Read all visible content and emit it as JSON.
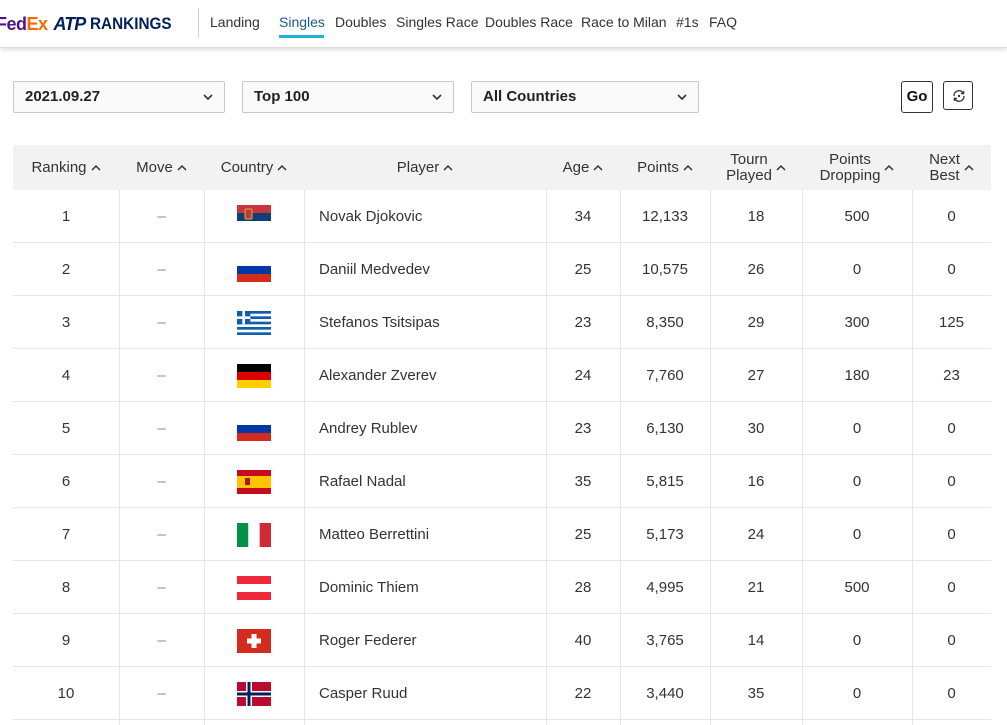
{
  "brand": {
    "fed": "Fed",
    "ex": "Ex",
    "atp": "ATP",
    "rankings": "RANKINGS"
  },
  "nav": {
    "items": [
      "Landing",
      "Singles",
      "Doubles",
      "Singles Race",
      "Doubles Race",
      "Race to Milan",
      "#1s",
      "FAQ"
    ],
    "active": "Singles"
  },
  "filters": {
    "date": "2021.09.27",
    "range": "Top 100",
    "country": "All Countries",
    "go_label": "Go",
    "reset_icon": "reset-icon"
  },
  "table": {
    "headers": {
      "ranking": "Ranking",
      "move": "Move",
      "country": "Country",
      "player": "Player",
      "age": "Age",
      "points": "Points",
      "tourn_line1": "Tourn",
      "tourn_line2": "Played",
      "dropping_line1": "Points",
      "dropping_line2": "Dropping",
      "next_line1": "Next",
      "next_line2": "Best"
    },
    "rows": [
      {
        "ranking": "1",
        "move": "–",
        "country": "SRB",
        "player": "Novak Djokovic",
        "age": "34",
        "points": "12,133",
        "tourn": "18",
        "dropping": "500",
        "next": "0"
      },
      {
        "ranking": "2",
        "move": "–",
        "country": "RUS",
        "player": "Daniil Medvedev",
        "age": "25",
        "points": "10,575",
        "tourn": "26",
        "dropping": "0",
        "next": "0"
      },
      {
        "ranking": "3",
        "move": "–",
        "country": "GRE",
        "player": "Stefanos Tsitsipas",
        "age": "23",
        "points": "8,350",
        "tourn": "29",
        "dropping": "300",
        "next": "125"
      },
      {
        "ranking": "4",
        "move": "–",
        "country": "GER",
        "player": "Alexander Zverev",
        "age": "24",
        "points": "7,760",
        "tourn": "27",
        "dropping": "180",
        "next": "23"
      },
      {
        "ranking": "5",
        "move": "–",
        "country": "RUS",
        "player": "Andrey Rublev",
        "age": "23",
        "points": "6,130",
        "tourn": "30",
        "dropping": "0",
        "next": "0"
      },
      {
        "ranking": "6",
        "move": "–",
        "country": "ESP",
        "player": "Rafael Nadal",
        "age": "35",
        "points": "5,815",
        "tourn": "16",
        "dropping": "0",
        "next": "0"
      },
      {
        "ranking": "7",
        "move": "–",
        "country": "ITA",
        "player": "Matteo Berrettini",
        "age": "25",
        "points": "5,173",
        "tourn": "24",
        "dropping": "0",
        "next": "0"
      },
      {
        "ranking": "8",
        "move": "–",
        "country": "AUT",
        "player": "Dominic Thiem",
        "age": "28",
        "points": "4,995",
        "tourn": "21",
        "dropping": "500",
        "next": "0"
      },
      {
        "ranking": "9",
        "move": "–",
        "country": "SUI",
        "player": "Roger Federer",
        "age": "40",
        "points": "3,765",
        "tourn": "14",
        "dropping": "0",
        "next": "0"
      },
      {
        "ranking": "10",
        "move": "–",
        "country": "NOR",
        "player": "Casper Ruud",
        "age": "22",
        "points": "3,440",
        "tourn": "35",
        "dropping": "0",
        "next": "0"
      }
    ]
  },
  "colors": {
    "fedex_purple": "#4d148c",
    "fedex_orange": "#ff6600",
    "atp_navy": "#00205b",
    "nav_active": "#1b5a8c",
    "nav_underline": "#1fb0e0",
    "header_bg": "#f2f2f2"
  }
}
